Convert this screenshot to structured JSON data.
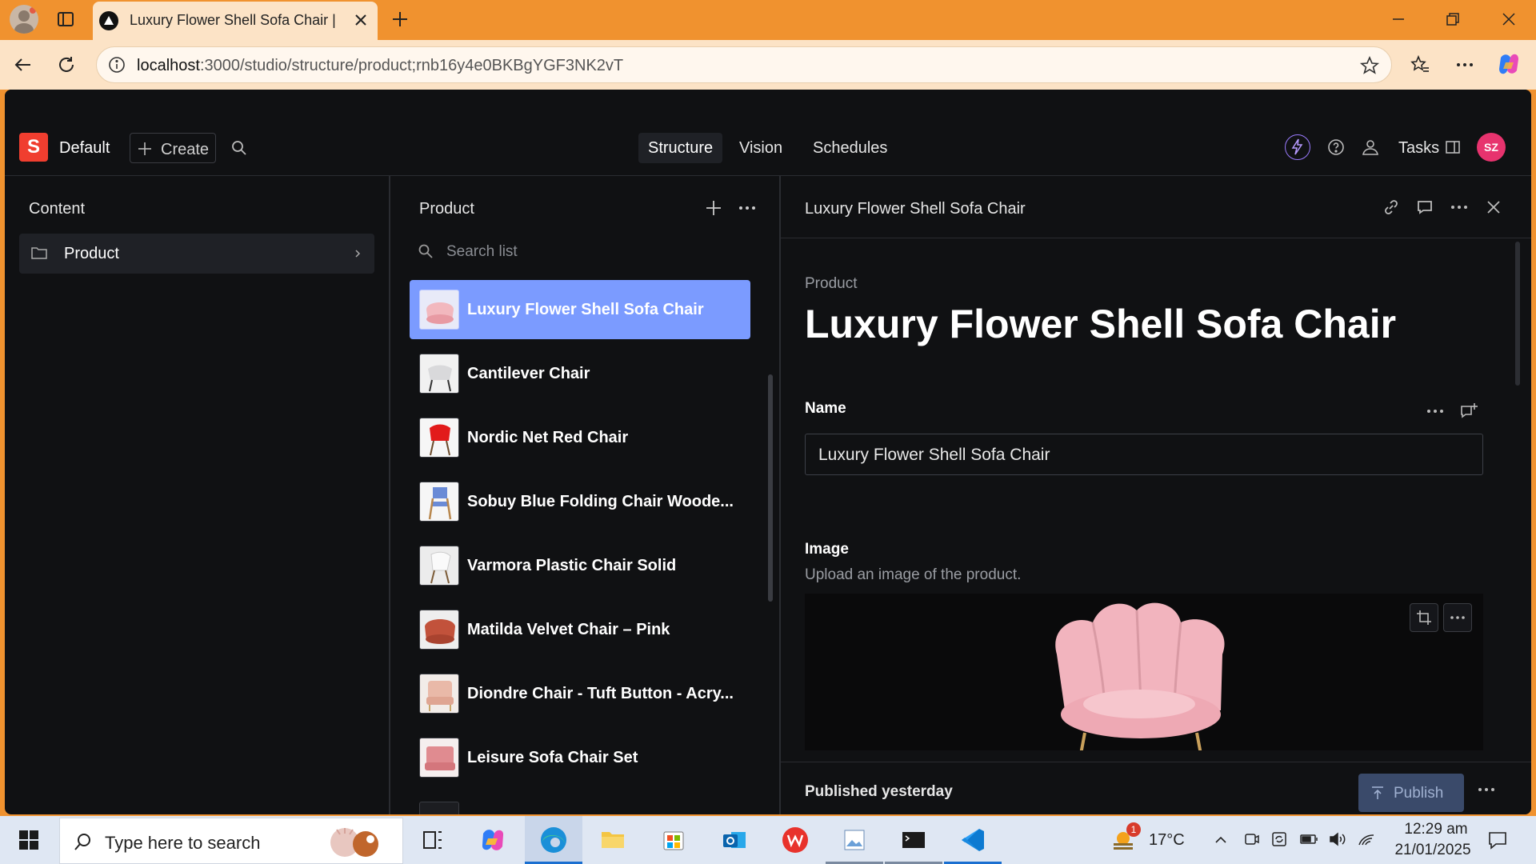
{
  "browser": {
    "tab_title": "Luxury Flower Shell Sofa Chair | D",
    "url_host": "localhost",
    "url_path": ":3000/studio/structure/product;rnb16y4e0BKBgYGF3NK2vT"
  },
  "studio": {
    "workspace": "Default",
    "logo_letter": "S",
    "create_label": "Create",
    "nav_tabs": [
      "Structure",
      "Vision",
      "Schedules"
    ],
    "tasks_label": "Tasks",
    "avatar_initials": "SZ"
  },
  "content_pane": {
    "title": "Content",
    "items": [
      {
        "label": "Product"
      }
    ]
  },
  "list_pane": {
    "title": "Product",
    "search_placeholder": "Search list",
    "items": [
      {
        "label": "Luxury Flower Shell Sofa Chair",
        "selected": true
      },
      {
        "label": "Cantilever Chair"
      },
      {
        "label": "Nordic Net Red Chair"
      },
      {
        "label": "Sobuy Blue Folding Chair Woode..."
      },
      {
        "label": "Varmora Plastic Chair Solid"
      },
      {
        "label": "Matilda Velvet Chair – Pink"
      },
      {
        "label": "Diondre Chair - Tuft Button - Acry..."
      },
      {
        "label": "Leisure Sofa Chair Set"
      }
    ]
  },
  "document": {
    "header_title": "Luxury Flower Shell Sofa Chair",
    "type_label": "Product",
    "heading": "Luxury Flower Shell Sofa Chair",
    "name_label": "Name",
    "name_value": "Luxury Flower Shell Sofa Chair",
    "image_label": "Image",
    "image_description": "Upload an image of the product.",
    "status_text": "Published yesterday",
    "publish_label": "Publish"
  },
  "taskbar": {
    "search_placeholder": "Type here to search",
    "temperature": "17°C",
    "weather_badge": "1",
    "time": "12:29 am",
    "date": "21/01/2025"
  },
  "colors": {
    "browser_frame": "#f0922f",
    "browser_light": "#fce3c6",
    "app_bg": "#101113",
    "selected_item": "#7b9bff",
    "brand_red": "#f03e2f",
    "avatar": "#e7336e"
  }
}
